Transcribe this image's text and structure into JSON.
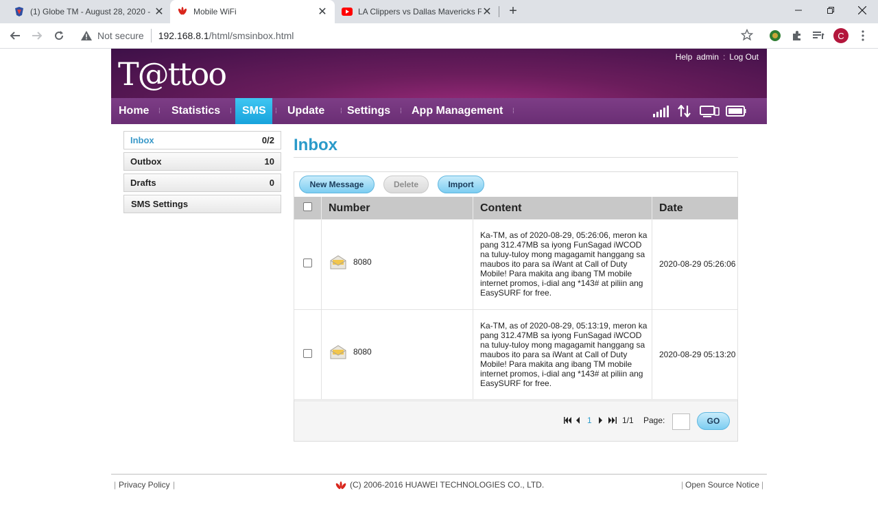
{
  "browser": {
    "tabs": [
      {
        "title": "(1) Globe TM - August 28, 2020 -",
        "icon": "globe-favicon"
      },
      {
        "title": "Mobile WiFi",
        "icon": "huawei-favicon"
      },
      {
        "title": "LA Clippers vs Dallas Mavericks F",
        "icon": "youtube-favicon"
      }
    ],
    "security_label": "Not secure",
    "url_host": "192.168.8.1",
    "url_path": "/html/smsinbox.html",
    "avatar_letter": "C"
  },
  "header": {
    "logo": "T@ttoo",
    "links": [
      "Help",
      "admin",
      "Log Out"
    ]
  },
  "nav": {
    "items": [
      "Home",
      "Statistics",
      "SMS",
      "Update",
      "Settings",
      "App Management"
    ],
    "active": "SMS"
  },
  "sidebar": {
    "items": [
      {
        "label": "Inbox",
        "count": "0/2"
      },
      {
        "label": "Outbox",
        "count": "10"
      },
      {
        "label": "Drafts",
        "count": "0"
      },
      {
        "label": "SMS Settings",
        "count": ""
      }
    ]
  },
  "main": {
    "title": "Inbox",
    "buttons": {
      "new": "New Message",
      "delete": "Delete",
      "import": "Import"
    },
    "columns": {
      "number": "Number",
      "content": "Content",
      "date": "Date"
    },
    "messages": [
      {
        "number": "8080",
        "content": "Ka-TM, as of 2020-08-29, 05:26:06, meron ka pang 312.47MB sa iyong FunSagad iWCOD na tuluy-tuloy mong magagamit hanggang sa maubos ito para sa iWant at Call of Duty Mobile! Para makita ang ibang TM mobile internet promos, i-dial ang *143# at piliin ang EasySURF for free.",
        "date": "2020-08-29 05:26:06"
      },
      {
        "number": "8080",
        "content": "Ka-TM, as of 2020-08-29, 05:13:19, meron ka pang 312.47MB sa iyong FunSagad iWCOD na tuluy-tuloy mong magagamit hanggang sa maubos ito para sa iWant at Call of Duty Mobile! Para makita ang ibang TM mobile internet promos, i-dial ang *143# at piliin ang EasySURF for free.",
        "date": "2020-08-29 05:13:20"
      }
    ],
    "pager": {
      "current": "1",
      "total": "1/1",
      "page_label": "Page:",
      "go": "GO"
    }
  },
  "footer": {
    "privacy": "Privacy Policy",
    "copyright": "(C) 2006-2016 HUAWEI TECHNOLOGIES CO., LTD.",
    "open_source": "Open Source Notice"
  }
}
